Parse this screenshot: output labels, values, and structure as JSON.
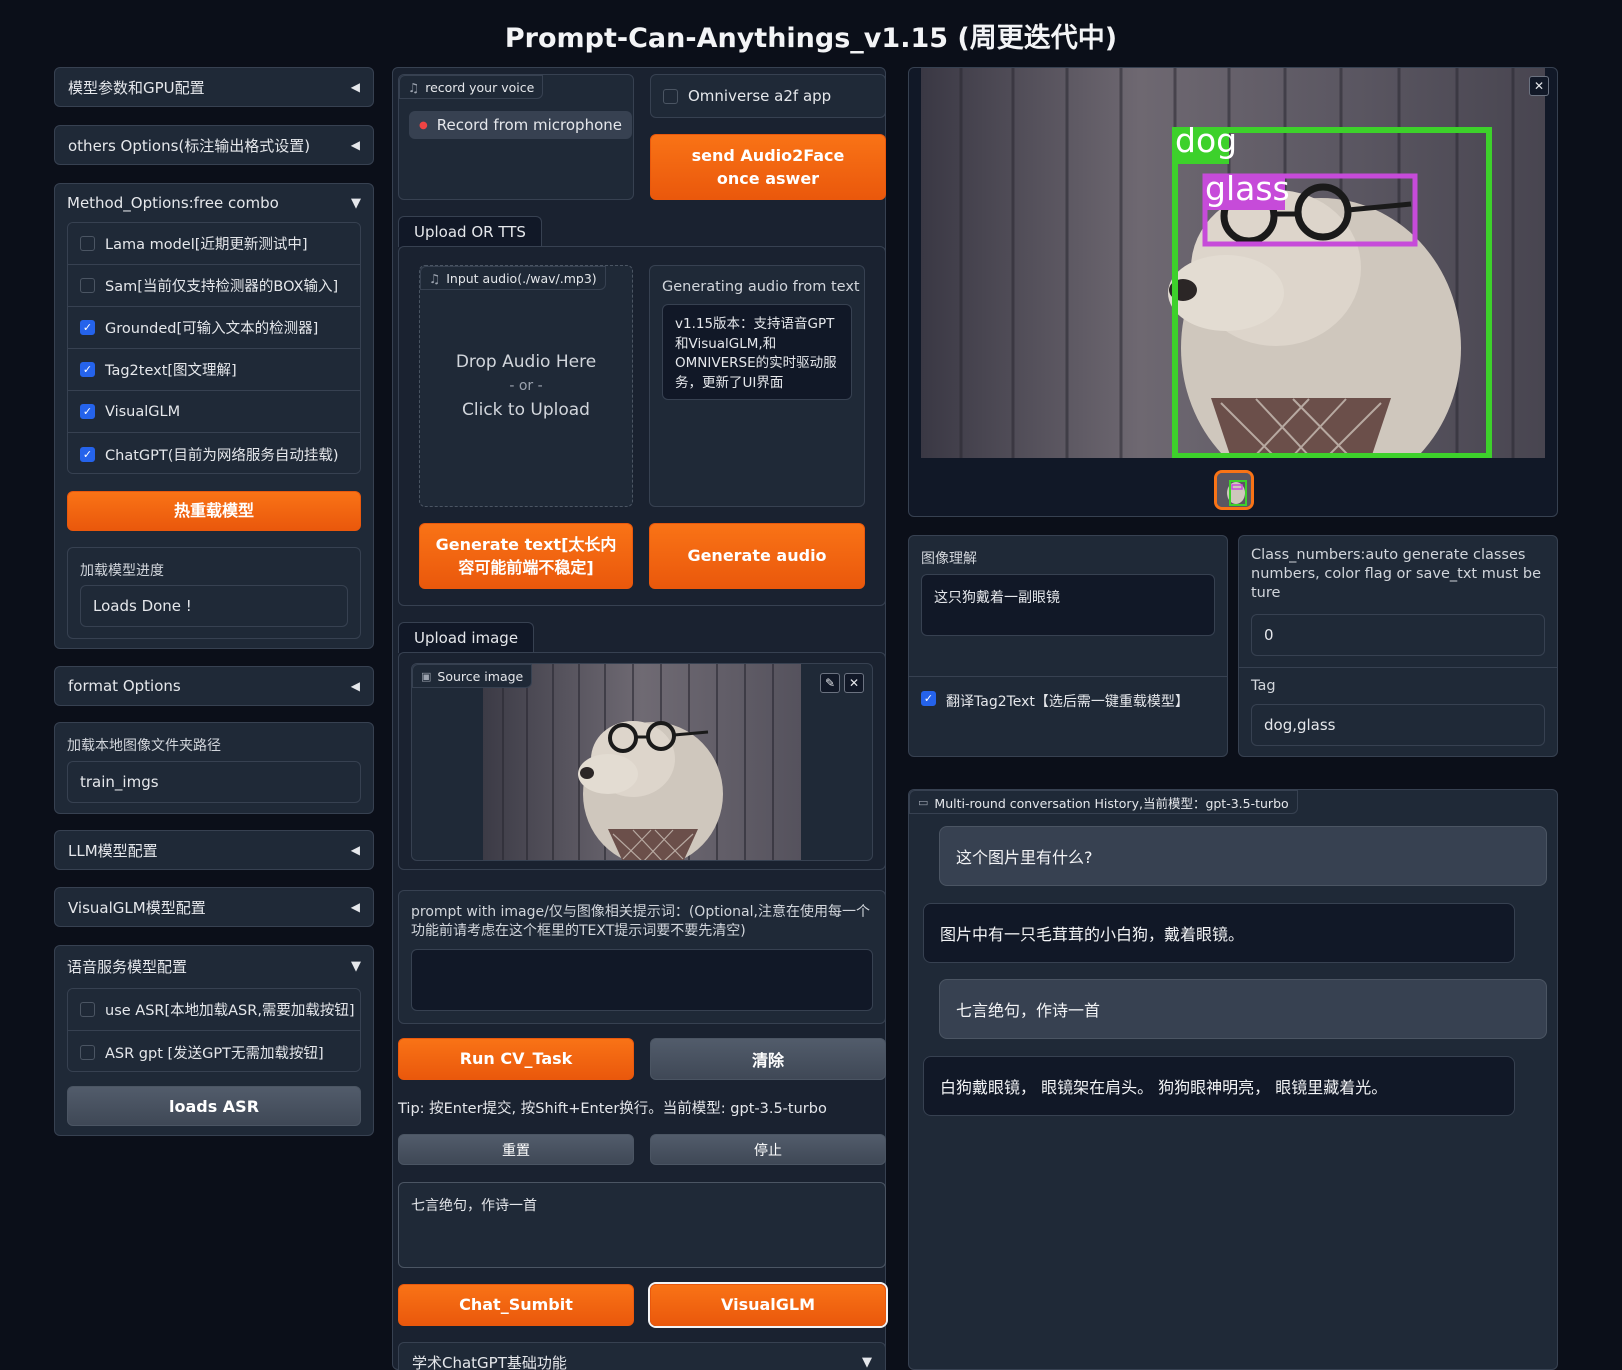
{
  "app": {
    "title": "Prompt-Can-Anythings_v1.15 (周更迭代中)"
  },
  "left": {
    "acc_model_gpu": "模型参数和GPU配置",
    "acc_others": "others Options(标注输出格式设置)",
    "acc_method": "Method_Options:free combo",
    "methods": [
      {
        "label": "Lama model[近期更新测试中]",
        "checked": false
      },
      {
        "label": "Sam[当前仅支持检测器的BOX输入]",
        "checked": false
      },
      {
        "label": "Grounded[可输入文本的检测器]",
        "checked": true
      },
      {
        "label": "Tag2text[图文理解]",
        "checked": true
      },
      {
        "label": "VisualGLM",
        "checked": true
      },
      {
        "label": "ChatGPT(目前为网络服务自动挂载)",
        "checked": true
      }
    ],
    "reload_button": "热重载模型",
    "progress_label": "加载模型进度",
    "progress_value": "Loads Done !",
    "acc_format": "format Options",
    "folder_label": "加载本地图像文件夹路径",
    "folder_value": "train_imgs",
    "acc_llm": "LLM模型配置",
    "acc_visualglm": "VisualGLM模型配置",
    "acc_speech": "语音服务模型配置",
    "speech_opts": [
      {
        "label": "use ASR[本地加载ASR,需要加载按钮]",
        "checked": false
      },
      {
        "label": "ASR gpt [发送GPT无需加载按钮]",
        "checked": false
      }
    ],
    "load_asr_button": "loads ASR"
  },
  "middle": {
    "voice_badge": "record your voice",
    "record_button": "Record from microphone",
    "omniverse_label": "Omniverse a2f app",
    "send_a2f_button": "send Audio2Face once aswer",
    "tab_upload_tts": "Upload OR TTS",
    "audio_badge": "Input audio(./wav/.mp3)",
    "drop_audio": "Drop Audio Here",
    "or_text": "- or -",
    "click_upload": "Click to Upload",
    "gen_text_label": "Generating audio from text",
    "gen_text_value": "v1.15版本：支持语音GPT和VisualGLM,和OMNIVERSE的实时驱动服务，更新了UI界面",
    "gen_text_button": "Generate text[太长内容可能前端不稳定]",
    "gen_audio_button": "Generate audio",
    "tab_upload_image": "Upload image",
    "source_badge": "Source image",
    "prompt_label": "prompt with image/仅与图像相关提示词：(Optional,注意在使用每一个功能前请考虑在这个框里的TEXT提示词要不要先清空)",
    "prompt_value": "",
    "run_cv_button": "Run CV_Task",
    "clear_button": "清除",
    "tip_text": "Tip: 按Enter提交, 按Shift+Enter换行。当前模型: gpt-3.5-turbo",
    "reset_button": "重置",
    "stop_button": "停止",
    "chat_input_value": "七言绝句，作诗一首",
    "chat_submit_button": "Chat_Sumbit",
    "visualglm_button": "VisualGLM",
    "acc_academic": "学术ChatGPT基础功能"
  },
  "right": {
    "det_labels": [
      "dog",
      "glass"
    ],
    "understand_label": "图像理解",
    "understand_value": "这只狗戴着一副眼镜",
    "translate_label": "翻译Tag2Text【选后需一键重载模型】",
    "translate_checked": true,
    "class_label": "Class_numbers:auto generate classes numbers, color flag or save_txt must be ture",
    "class_value": "0",
    "tag_label": "Tag",
    "tag_value": "dog,glass",
    "history_badge": "Multi-round conversation History,当前模型：gpt-3.5-turbo",
    "messages": [
      {
        "role": "user",
        "text": "这个图片里有什么?"
      },
      {
        "role": "bot",
        "text": "图片中有一只毛茸茸的小白狗，戴着眼镜。"
      },
      {
        "role": "user",
        "text": "七言绝句，作诗一首"
      },
      {
        "role": "bot",
        "text": "白狗戴眼镜， 眼镜架在肩头。 狗狗眼神明亮， 眼镜里藏着光。"
      }
    ]
  },
  "colors": {
    "accent": "#f97316",
    "background": "#0b0f19",
    "panel": "#1f2937",
    "checked": "#2563eb",
    "dog_box": "#3dd12b",
    "glass_box": "#c64bd9"
  }
}
